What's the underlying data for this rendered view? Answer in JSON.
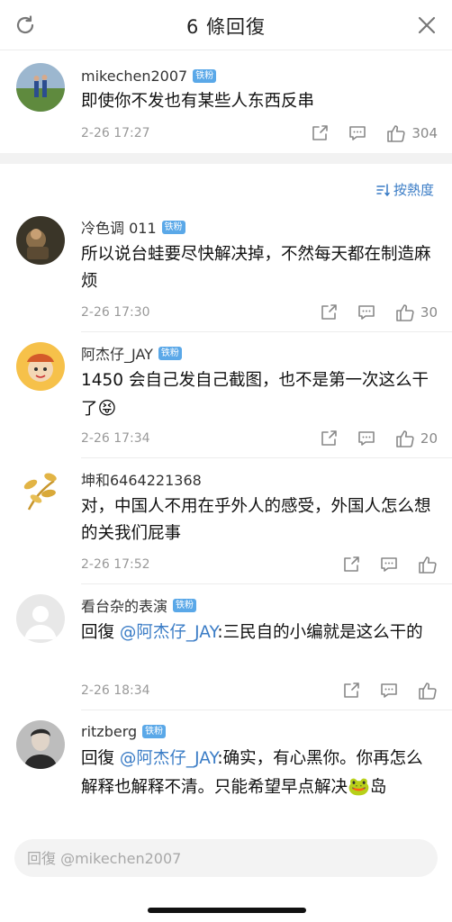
{
  "header": {
    "title": "6 條回復",
    "refresh_icon": "refresh-icon",
    "close_icon": "close-icon"
  },
  "badge_label": "铁粉",
  "sort": {
    "label": "按熱度",
    "icon": "sort-icon"
  },
  "root_comment": {
    "username": "mikechen2007",
    "content": "即使你不发也有某些人东西反串",
    "time": "2-26 17:27",
    "likes": "304"
  },
  "comments": [
    {
      "username": "冷色调 011",
      "content": "所以说台蛙要尽快解决掉，不然每天都在制造麻烦",
      "time": "2-26 17:30",
      "likes": "30"
    },
    {
      "username": "阿杰仔_JAY",
      "content": "1450 会自己发自己截图，也不是第一次这么干了",
      "emoji": "😝",
      "time": "2-26 17:34",
      "likes": "20"
    },
    {
      "username": "坤和6464221368",
      "content": "对，中国人不用在乎外人的感受，外国人怎么想的关我们屁事",
      "time": "2-26 17:52",
      "likes": ""
    },
    {
      "username": "看台杂的表演",
      "reply_prefix": "回復 ",
      "mention": "@阿杰仔_JAY",
      "content": ":三民自的小编就是这么干的",
      "time": "2-26 18:34",
      "likes": ""
    },
    {
      "username": "ritzberg",
      "reply_prefix": "回復 ",
      "mention": "@阿杰仔_JAY",
      "content": ":确实，有心黑你。你再怎么解释也解释不清。只能希望早点解决",
      "emoji": "🐸",
      "content_tail": "岛"
    }
  ],
  "reply_bar": {
    "placeholder": "回復 @mikechen2007"
  },
  "colors": {
    "accent": "#3a7cc6",
    "badge": "#5aa8e8",
    "separator": "#f2f2f2"
  }
}
